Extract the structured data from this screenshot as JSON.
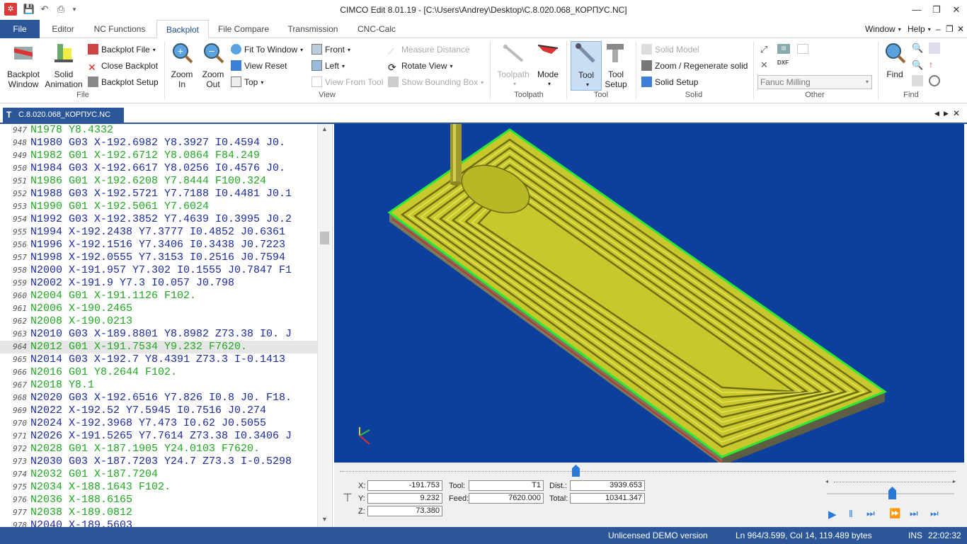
{
  "window": {
    "title": "CIMCO Edit 8.01.19 - [C:\\Users\\Andrey\\Desktop\\C.8.020.068_КОРПУС.NC]"
  },
  "ribbon_tabs": [
    "File",
    "Editor",
    "NC Functions",
    "Backplot",
    "File Compare",
    "Transmission",
    "CNC-Calc"
  ],
  "ribbon_right": {
    "window": "Window",
    "help": "Help"
  },
  "ribbon": {
    "file_group": {
      "label": "File",
      "backplot_window": "Backplot Window",
      "solid_animation": "Solid Animation",
      "backplot_file": "Backplot File",
      "close_backplot": "Close Backplot",
      "backplot_setup": "Backplot Setup"
    },
    "view_group": {
      "label": "View",
      "zoom_in": "Zoom In",
      "zoom_out": "Zoom Out",
      "fit_to_window": "Fit To Window",
      "view_reset": "View Reset",
      "top": "Top",
      "front": "Front",
      "left": "Left",
      "view_from_tool": "View From Tool",
      "measure_distance": "Measure Distance",
      "rotate_view": "Rotate View",
      "show_bounding_box": "Show Bounding Box"
    },
    "toolpath_group": {
      "label": "Toolpath",
      "toolpath": "Toolpath",
      "mode": "Mode"
    },
    "tool_group": {
      "label": "Tool",
      "tool": "Tool",
      "tool_setup": "Tool Setup"
    },
    "solid_group": {
      "label": "Solid",
      "solid_model": "Solid Model",
      "zoom_regenerate": "Zoom / Regenerate solid",
      "solid_setup": "Solid Setup"
    },
    "other_group": {
      "label": "Other",
      "machine": "Fanuc Milling"
    },
    "find_group": {
      "label": "Find",
      "find": "Find"
    }
  },
  "document_tab": "C.8.020.068_КОРПУС.NC",
  "editor_lines": [
    {
      "n": "947",
      "text": "N1978 Y8.4332",
      "color": "green"
    },
    {
      "n": "948",
      "text": "N1980 G03 X-192.6982 Y8.3927 I0.4594 J0.",
      "color": "blue"
    },
    {
      "n": "949",
      "text": "N1982 G01 X-192.6712 Y8.0864 F84.249",
      "color": "green"
    },
    {
      "n": "950",
      "text": "N1984 G03 X-192.6617 Y8.0256 I0.4576 J0.",
      "color": "blue"
    },
    {
      "n": "951",
      "text": "N1986 G01 X-192.6208 Y7.8444 F100.324",
      "color": "green"
    },
    {
      "n": "952",
      "text": "N1988 G03 X-192.5721 Y7.7188 I0.4481 J0.1",
      "color": "blue"
    },
    {
      "n": "953",
      "text": "N1990 G01 X-192.5061 Y7.6024",
      "color": "green"
    },
    {
      "n": "954",
      "text": "N1992 G03 X-192.3852 Y7.4639 I0.3995 J0.2",
      "color": "blue"
    },
    {
      "n": "955",
      "text": "N1994 X-192.2438 Y7.3777 I0.4852 J0.6361",
      "color": "blue"
    },
    {
      "n": "956",
      "text": "N1996 X-192.1516 Y7.3406 I0.3438 J0.7223",
      "color": "blue"
    },
    {
      "n": "957",
      "text": "N1998 X-192.0555 Y7.3153 I0.2516 J0.7594",
      "color": "blue"
    },
    {
      "n": "958",
      "text": "N2000 X-191.957 Y7.302 I0.1555 J0.7847 F1",
      "color": "blue"
    },
    {
      "n": "959",
      "text": "N2002 X-191.9 Y7.3 I0.057 J0.798",
      "color": "blue"
    },
    {
      "n": "960",
      "text": "N2004 G01 X-191.1126 F102.",
      "color": "green"
    },
    {
      "n": "961",
      "text": "N2006 X-190.2465",
      "color": "green"
    },
    {
      "n": "962",
      "text": "N2008 X-190.0213",
      "color": "green"
    },
    {
      "n": "963",
      "text": "N2010 G03 X-189.8801 Y8.8982 Z73.38 I0. J",
      "color": "blue"
    },
    {
      "n": "964",
      "text": "N2012 G01 X-191.7534 Y9.232 F7620.",
      "color": "green",
      "highlight": true
    },
    {
      "n": "965",
      "text": "N2014 G03 X-192.7 Y8.4391 Z73.3 I-0.1413",
      "color": "blue"
    },
    {
      "n": "966",
      "text": "N2016 G01 Y8.2644 F102.",
      "color": "green"
    },
    {
      "n": "967",
      "text": "N2018 Y8.1",
      "color": "green"
    },
    {
      "n": "968",
      "text": "N2020 G03 X-192.6516 Y7.826 I0.8 J0. F18.",
      "color": "blue"
    },
    {
      "n": "969",
      "text": "N2022 X-192.52 Y7.5945 I0.7516 J0.274",
      "color": "blue"
    },
    {
      "n": "970",
      "text": "N2024 X-192.3968 Y7.473 I0.62 J0.5055",
      "color": "blue"
    },
    {
      "n": "971",
      "text": "N2026 X-191.5265 Y7.7614 Z73.38 I0.3406 J",
      "color": "blue"
    },
    {
      "n": "972",
      "text": "N2028 G01 X-187.1905 Y24.0103 F7620.",
      "color": "green"
    },
    {
      "n": "973",
      "text": "N2030 G03 X-187.7203 Y24.7 Z73.3 I-0.5298",
      "color": "blue"
    },
    {
      "n": "974",
      "text": "N2032 G01 X-187.7204",
      "color": "green"
    },
    {
      "n": "975",
      "text": "N2034 X-188.1643 F102.",
      "color": "green"
    },
    {
      "n": "976",
      "text": "N2036 X-188.6165",
      "color": "green"
    },
    {
      "n": "977",
      "text": "N2038 X-189.0812",
      "color": "green"
    },
    {
      "n": "978",
      "text": "N2040 X-189.5603",
      "color": "blue"
    }
  ],
  "colors": {
    "blue_code": "#1a2aa0",
    "green_code": "#1fa81f",
    "accent": "#2b579a",
    "viewport_bg": "#0d3f9c",
    "part": "#c6c62a"
  },
  "readout": {
    "x_label": "X:",
    "x": "-191.753",
    "y_label": "Y:",
    "y": "9.232",
    "z_label": "Z:",
    "z": "73.380",
    "tool_label": "Tool:",
    "tool": "T1",
    "feed_label": "Feed:",
    "feed": "7620.000",
    "dist_label": "Dist.:",
    "dist": "3939.653",
    "total_label": "Total:",
    "total": "10341.347"
  },
  "status": {
    "license": "Unlicensed DEMO version",
    "position": "Ln 964/3.599, Col 14, 119.489 bytes",
    "mode": "INS",
    "time": "22:02:32"
  }
}
